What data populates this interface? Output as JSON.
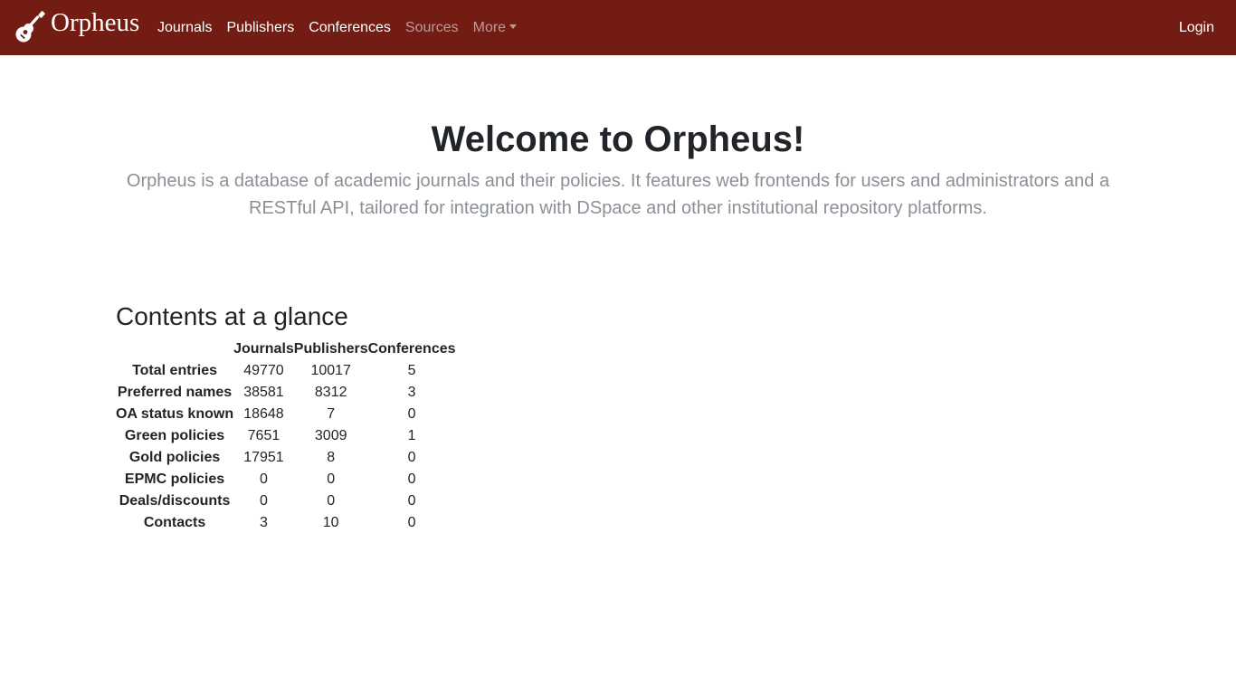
{
  "navbar": {
    "brand": "Orpheus",
    "brand_icon": "guitar-icon",
    "links": [
      {
        "label": "Journals",
        "state": "active"
      },
      {
        "label": "Publishers",
        "state": "active"
      },
      {
        "label": "Conferences",
        "state": "active"
      },
      {
        "label": "Sources",
        "state": "muted"
      },
      {
        "label": "More",
        "state": "muted",
        "dropdown": true
      }
    ],
    "login": "Login",
    "background_color": "#721c13"
  },
  "hero": {
    "title": "Welcome to Orpheus!",
    "lead": "Orpheus is a database of academic journals and their policies. It features web frontends for users and administrators and a RESTful API, tailored for integration with DSpace and other institutional repository platforms."
  },
  "glance": {
    "title": "Contents at a glance",
    "columns": [
      "Journals",
      "Publishers",
      "Conferences"
    ],
    "rows": [
      {
        "label": "Total entries",
        "values": [
          "49770",
          "10017",
          "5"
        ]
      },
      {
        "label": "Preferred names",
        "values": [
          "38581",
          "8312",
          "3"
        ]
      },
      {
        "label": "OA status known",
        "values": [
          "18648",
          "7",
          "0"
        ]
      },
      {
        "label": "Green policies",
        "values": [
          "7651",
          "3009",
          "1"
        ]
      },
      {
        "label": "Gold policies",
        "values": [
          "17951",
          "8",
          "0"
        ]
      },
      {
        "label": "EPMC policies",
        "values": [
          "0",
          "0",
          "0"
        ]
      },
      {
        "label": "Deals/discounts",
        "values": [
          "0",
          "0",
          "0"
        ]
      },
      {
        "label": "Contacts",
        "values": [
          "3",
          "10",
          "0"
        ]
      }
    ]
  }
}
